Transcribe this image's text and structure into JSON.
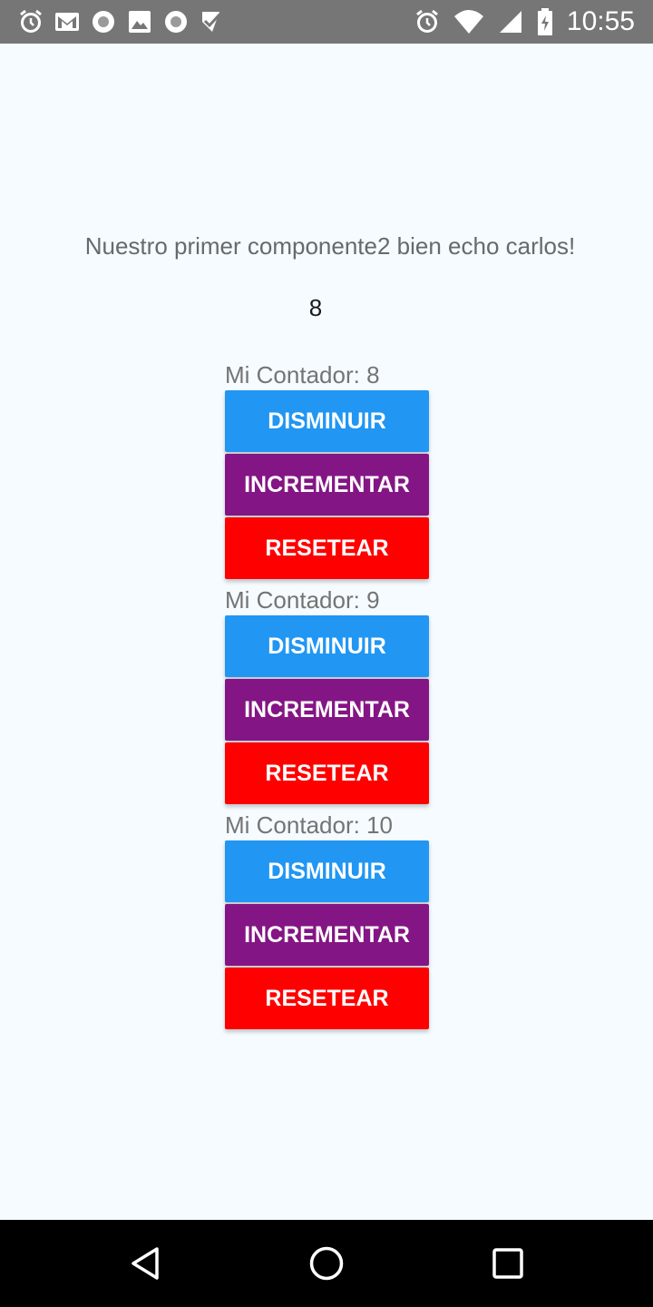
{
  "status_bar": {
    "time": "10:55",
    "left_icons": [
      "alarm-icon",
      "gmail-icon",
      "record-icon",
      "image-icon",
      "record-icon",
      "checklist-icon"
    ],
    "right_icons": [
      "alarm-icon",
      "wifi-icon",
      "signal-icon",
      "battery-charging-icon"
    ]
  },
  "app": {
    "headline": "Nuestro primer componente2 bien echo carlos!",
    "count": "8",
    "counters": [
      {
        "label": "Mi Contador: 8",
        "decrement": "DISMINUIR",
        "increment": "INCREMENTAR",
        "reset": "RESETEAR"
      },
      {
        "label": "Mi Contador: 9",
        "decrement": "DISMINUIR",
        "increment": "INCREMENTAR",
        "reset": "RESETEAR"
      },
      {
        "label": "Mi Contador: 10",
        "decrement": "DISMINUIR",
        "increment": "INCREMENTAR",
        "reset": "RESETEAR"
      }
    ]
  },
  "colors": {
    "decrement": "#2196f3",
    "increment": "#841584",
    "reset": "#ff0000",
    "status_bar": "#767676",
    "background": "#f5fbff"
  },
  "nav_bar": {
    "buttons": [
      "back-icon",
      "home-icon",
      "recents-icon"
    ]
  }
}
